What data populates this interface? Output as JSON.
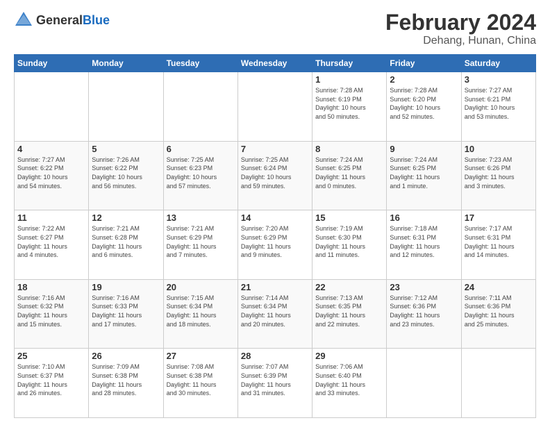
{
  "logo": {
    "general": "General",
    "blue": "Blue"
  },
  "title": {
    "month_year": "February 2024",
    "location": "Dehang, Hunan, China"
  },
  "days_of_week": [
    "Sunday",
    "Monday",
    "Tuesday",
    "Wednesday",
    "Thursday",
    "Friday",
    "Saturday"
  ],
  "weeks": [
    [
      {
        "day": "",
        "info": ""
      },
      {
        "day": "",
        "info": ""
      },
      {
        "day": "",
        "info": ""
      },
      {
        "day": "",
        "info": ""
      },
      {
        "day": "1",
        "info": "Sunrise: 7:28 AM\nSunset: 6:19 PM\nDaylight: 10 hours\nand 50 minutes."
      },
      {
        "day": "2",
        "info": "Sunrise: 7:28 AM\nSunset: 6:20 PM\nDaylight: 10 hours\nand 52 minutes."
      },
      {
        "day": "3",
        "info": "Sunrise: 7:27 AM\nSunset: 6:21 PM\nDaylight: 10 hours\nand 53 minutes."
      }
    ],
    [
      {
        "day": "4",
        "info": "Sunrise: 7:27 AM\nSunset: 6:22 PM\nDaylight: 10 hours\nand 54 minutes."
      },
      {
        "day": "5",
        "info": "Sunrise: 7:26 AM\nSunset: 6:22 PM\nDaylight: 10 hours\nand 56 minutes."
      },
      {
        "day": "6",
        "info": "Sunrise: 7:25 AM\nSunset: 6:23 PM\nDaylight: 10 hours\nand 57 minutes."
      },
      {
        "day": "7",
        "info": "Sunrise: 7:25 AM\nSunset: 6:24 PM\nDaylight: 10 hours\nand 59 minutes."
      },
      {
        "day": "8",
        "info": "Sunrise: 7:24 AM\nSunset: 6:25 PM\nDaylight: 11 hours\nand 0 minutes."
      },
      {
        "day": "9",
        "info": "Sunrise: 7:24 AM\nSunset: 6:25 PM\nDaylight: 11 hours\nand 1 minute."
      },
      {
        "day": "10",
        "info": "Sunrise: 7:23 AM\nSunset: 6:26 PM\nDaylight: 11 hours\nand 3 minutes."
      }
    ],
    [
      {
        "day": "11",
        "info": "Sunrise: 7:22 AM\nSunset: 6:27 PM\nDaylight: 11 hours\nand 4 minutes."
      },
      {
        "day": "12",
        "info": "Sunrise: 7:21 AM\nSunset: 6:28 PM\nDaylight: 11 hours\nand 6 minutes."
      },
      {
        "day": "13",
        "info": "Sunrise: 7:21 AM\nSunset: 6:29 PM\nDaylight: 11 hours\nand 7 minutes."
      },
      {
        "day": "14",
        "info": "Sunrise: 7:20 AM\nSunset: 6:29 PM\nDaylight: 11 hours\nand 9 minutes."
      },
      {
        "day": "15",
        "info": "Sunrise: 7:19 AM\nSunset: 6:30 PM\nDaylight: 11 hours\nand 11 minutes."
      },
      {
        "day": "16",
        "info": "Sunrise: 7:18 AM\nSunset: 6:31 PM\nDaylight: 11 hours\nand 12 minutes."
      },
      {
        "day": "17",
        "info": "Sunrise: 7:17 AM\nSunset: 6:31 PM\nDaylight: 11 hours\nand 14 minutes."
      }
    ],
    [
      {
        "day": "18",
        "info": "Sunrise: 7:16 AM\nSunset: 6:32 PM\nDaylight: 11 hours\nand 15 minutes."
      },
      {
        "day": "19",
        "info": "Sunrise: 7:16 AM\nSunset: 6:33 PM\nDaylight: 11 hours\nand 17 minutes."
      },
      {
        "day": "20",
        "info": "Sunrise: 7:15 AM\nSunset: 6:34 PM\nDaylight: 11 hours\nand 18 minutes."
      },
      {
        "day": "21",
        "info": "Sunrise: 7:14 AM\nSunset: 6:34 PM\nDaylight: 11 hours\nand 20 minutes."
      },
      {
        "day": "22",
        "info": "Sunrise: 7:13 AM\nSunset: 6:35 PM\nDaylight: 11 hours\nand 22 minutes."
      },
      {
        "day": "23",
        "info": "Sunrise: 7:12 AM\nSunset: 6:36 PM\nDaylight: 11 hours\nand 23 minutes."
      },
      {
        "day": "24",
        "info": "Sunrise: 7:11 AM\nSunset: 6:36 PM\nDaylight: 11 hours\nand 25 minutes."
      }
    ],
    [
      {
        "day": "25",
        "info": "Sunrise: 7:10 AM\nSunset: 6:37 PM\nDaylight: 11 hours\nand 26 minutes."
      },
      {
        "day": "26",
        "info": "Sunrise: 7:09 AM\nSunset: 6:38 PM\nDaylight: 11 hours\nand 28 minutes."
      },
      {
        "day": "27",
        "info": "Sunrise: 7:08 AM\nSunset: 6:38 PM\nDaylight: 11 hours\nand 30 minutes."
      },
      {
        "day": "28",
        "info": "Sunrise: 7:07 AM\nSunset: 6:39 PM\nDaylight: 11 hours\nand 31 minutes."
      },
      {
        "day": "29",
        "info": "Sunrise: 7:06 AM\nSunset: 6:40 PM\nDaylight: 11 hours\nand 33 minutes."
      },
      {
        "day": "",
        "info": ""
      },
      {
        "day": "",
        "info": ""
      }
    ]
  ]
}
